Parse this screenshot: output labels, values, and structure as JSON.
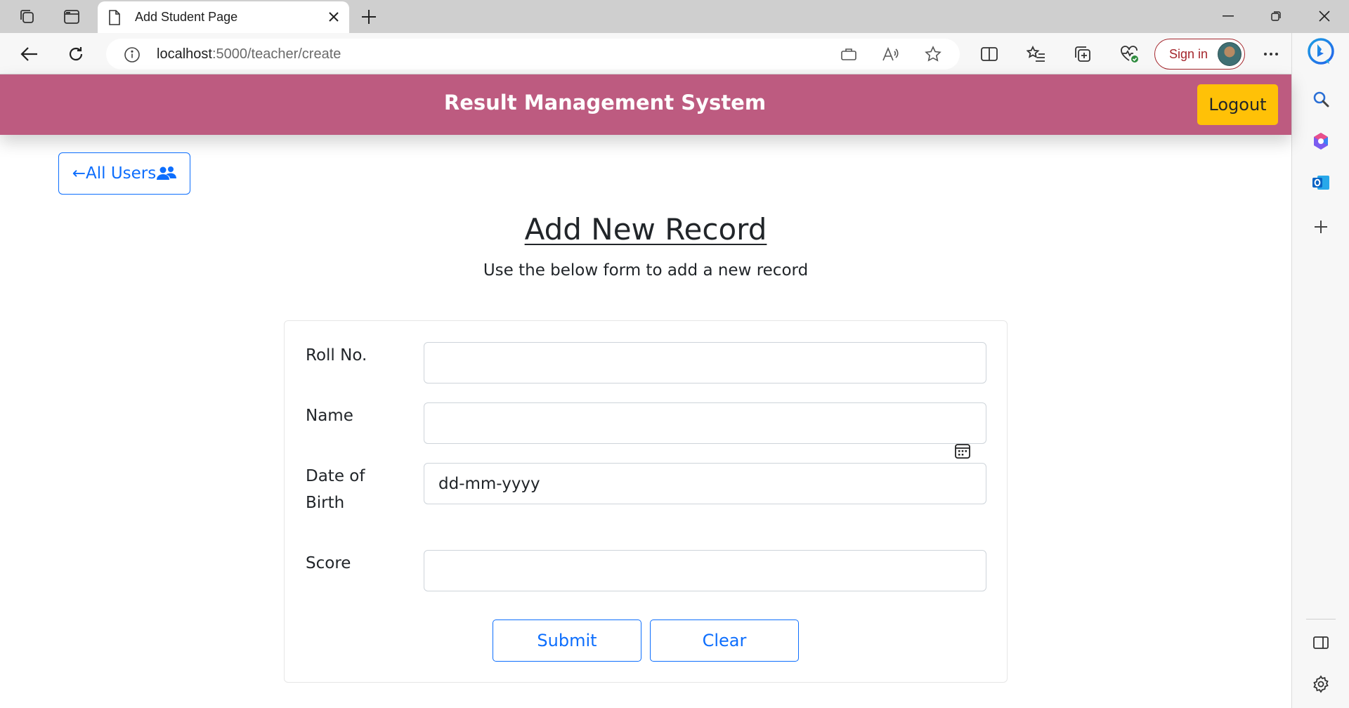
{
  "browser": {
    "tab_title": "Add Student Page",
    "url_host": "localhost",
    "url_path": ":5000/teacher/create",
    "sign_in_label": "Sign in"
  },
  "header": {
    "title": "Result Management System",
    "logout_label": "Logout",
    "background_color": "#bd5b80",
    "logout_color": "#ffc107"
  },
  "nav": {
    "back_link_label": "←All Users"
  },
  "main": {
    "heading": "Add New Record",
    "subheading": "Use the below form to add a new record"
  },
  "form": {
    "fields": [
      {
        "label": "Roll No.",
        "value": "",
        "placeholder": ""
      },
      {
        "label": "Name",
        "value": "",
        "placeholder": ""
      },
      {
        "label": "Date of Birth",
        "value": "",
        "placeholder": "dd-mm-yyyy"
      },
      {
        "label": "Score",
        "value": "",
        "placeholder": ""
      }
    ],
    "submit_label": "Submit",
    "clear_label": "Clear"
  },
  "accent_color": "#0d6efd"
}
